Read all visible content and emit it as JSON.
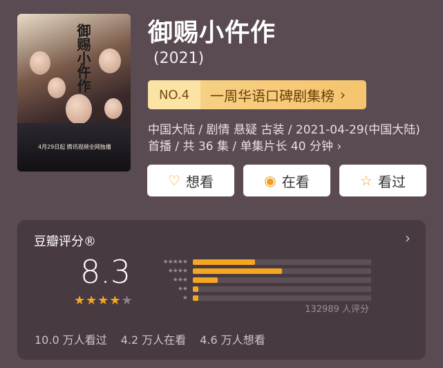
{
  "poster": {
    "title_text": "御赐小仵作",
    "date_text": "4月29日起 腾讯视频全网独播"
  },
  "show": {
    "title": "御赐小仵作",
    "year": "(2021)"
  },
  "rank": {
    "no": "NO.4",
    "list": "一周华语口碑剧集榜",
    "chevron": "›"
  },
  "meta": {
    "text": "中国大陆 / 剧情 悬疑 古装 / 2021-04-29(中国大陆) 首播 / 共 36 集 / 单集片长 40 分钟 ›"
  },
  "actions": {
    "want_icon": "♡",
    "want": "想看",
    "watching_icon": "◉",
    "watching": "在看",
    "watched_icon": "☆",
    "watched": "看过"
  },
  "rating": {
    "header": "豆瓣评分®",
    "chevron": "›",
    "score": "8.3",
    "stars_filled": 4,
    "stars_total": 5,
    "distribution": [
      {
        "label": "★★★★★",
        "fraction": 0.35
      },
      {
        "label": "★★★★",
        "fraction": 0.5
      },
      {
        "label": "★★★",
        "fraction": 0.14
      },
      {
        "label": "★★",
        "fraction": 0.03
      },
      {
        "label": "★",
        "fraction": 0.03
      }
    ],
    "count": "132989 人评分"
  },
  "stats": {
    "watched": "10.0 万人看过",
    "watching": "4.2 万人在看",
    "want": "4.6 万人想看"
  },
  "colors": {
    "accent": "#f5a623",
    "background": "#5a4a52",
    "card": "#483a41",
    "rank_bg": "#f7d58a"
  }
}
